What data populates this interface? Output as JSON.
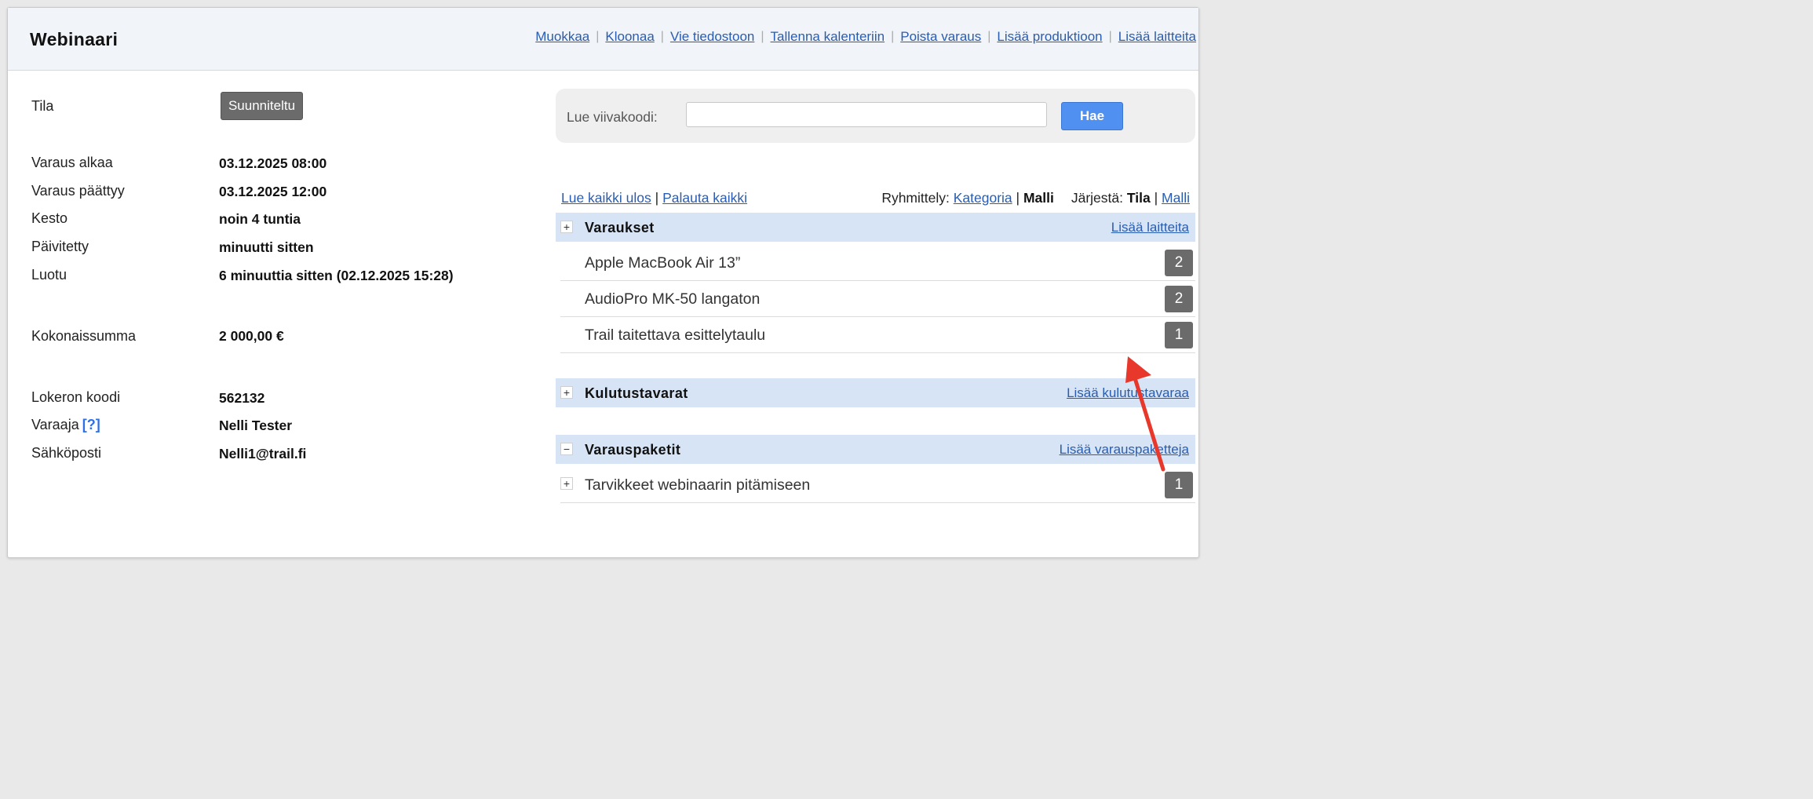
{
  "title": "Webinaari",
  "actions": [
    "Muokkaa",
    "Kloonaa",
    "Vie tiedostoon",
    "Tallenna kalenteriin",
    "Poista varaus",
    "Lisää produktioon",
    "Lisää laitteita"
  ],
  "details": {
    "status_label": "Tila",
    "status_value": "Suunniteltu",
    "start_label": "Varaus alkaa",
    "start_value": "03.12.2025 08:00",
    "end_label": "Varaus päättyy",
    "end_value": "03.12.2025 12:00",
    "duration_label": "Kesto",
    "duration_value": "noin 4 tuntia",
    "updated_label": "Päivitetty",
    "updated_value": "minuutti sitten",
    "created_label": "Luotu",
    "created_value": "6 minuuttia sitten (02.12.2025 15:28)",
    "total_label": "Kokonaissumma",
    "total_value": "2 000,00 €",
    "locker_label": "Lokeron koodi",
    "locker_value": "562132",
    "booker_label": "Varaaja",
    "booker_help": "[?]",
    "booker_value": "Nelli Tester",
    "email_label": "Sähköposti",
    "email_value": "Nelli1@trail.fi"
  },
  "barcode": {
    "label": "Lue viivakoodi:",
    "value": "",
    "button": "Hae"
  },
  "toolbar": {
    "checkout_all": "Lue kaikki ulos",
    "divider": "|",
    "return_all": "Palauta kaikki",
    "grouping_label": "Ryhmittely:",
    "grouping_category": "Kategoria",
    "grouping_model": "Malli",
    "sort_label": "Järjestä:",
    "sort_status": "Tila",
    "sort_model": "Malli"
  },
  "groups": {
    "reservations": {
      "toggle": "+",
      "title": "Varaukset",
      "link": "Lisää laitteita",
      "items": [
        {
          "name": "Apple MacBook Air 13”",
          "qty": "2"
        },
        {
          "name": "AudioPro MK-50 langaton",
          "qty": "2"
        },
        {
          "name": "Trail taitettava esittelytaulu",
          "qty": "1"
        }
      ]
    },
    "consumables": {
      "toggle": "+",
      "title": "Kulutustavarat",
      "link": "Lisää kulutustavaraa"
    },
    "packages": {
      "toggle": "−",
      "title": "Varauspaketit",
      "link": "Lisää varauspaketteja",
      "items": [
        {
          "toggle": "+",
          "name": "Tarvikkeet webinaarin pitämiseen",
          "qty": "1"
        }
      ]
    }
  },
  "annotation_color": "#e8382b"
}
